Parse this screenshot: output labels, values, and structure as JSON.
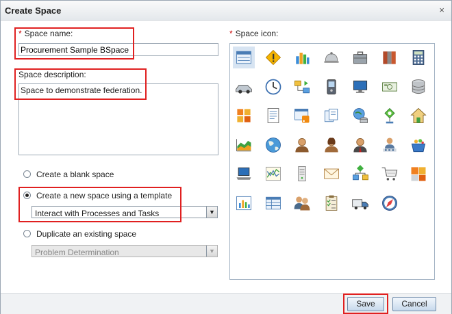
{
  "dialog": {
    "title": "Create Space",
    "close": "×"
  },
  "space_name": {
    "label": "Space name:",
    "required": "*",
    "value": "Procurement Sample BSpace"
  },
  "space_description": {
    "label": "Space description:",
    "value": "Space to demonstrate federation."
  },
  "options": {
    "blank": "Create a blank space",
    "template": "Create a new space using a template",
    "template_selected": "Interact with Processes and Tasks",
    "duplicate": "Duplicate an existing space",
    "duplicate_selected": "Problem Determination",
    "checked": "template"
  },
  "space_icon": {
    "label": "Space icon:",
    "required": "*",
    "selected_index": 0,
    "icons": [
      "layout-window-icon",
      "warning-icon",
      "bar-chart-icon",
      "service-bell-icon",
      "briefcase-icon",
      "binders-icon",
      "calculator-icon",
      "car-icon",
      "clock-icon",
      "workflow-icon",
      "pda-icon",
      "computer-monitor-icon",
      "money-icon",
      "database-icon",
      "puzzle-icon",
      "document-list-icon",
      "rss-feed-icon",
      "documents-icon",
      "globe-database-icon",
      "network-node-icon",
      "home-icon",
      "area-chart-icon",
      "globe-icon",
      "user-icon",
      "user-woman-icon",
      "user-tie-icon",
      "user-group-icon",
      "shopping-basket-icon",
      "laptop-icon",
      "line-chart-icon",
      "server-icon",
      "mail-icon",
      "process-flow-icon",
      "shopping-cart-icon",
      "widget-puzzle-icon",
      "report-chart-icon",
      "table-icon",
      "team-icon",
      "checklist-icon",
      "delivery-truck-icon",
      "compass-icon"
    ]
  },
  "footer": {
    "save": "Save",
    "cancel": "Cancel"
  },
  "colors": {
    "highlight": "#e02020",
    "selected_icon_bg": "#d7e4f2",
    "button": "#c7d9ec"
  }
}
